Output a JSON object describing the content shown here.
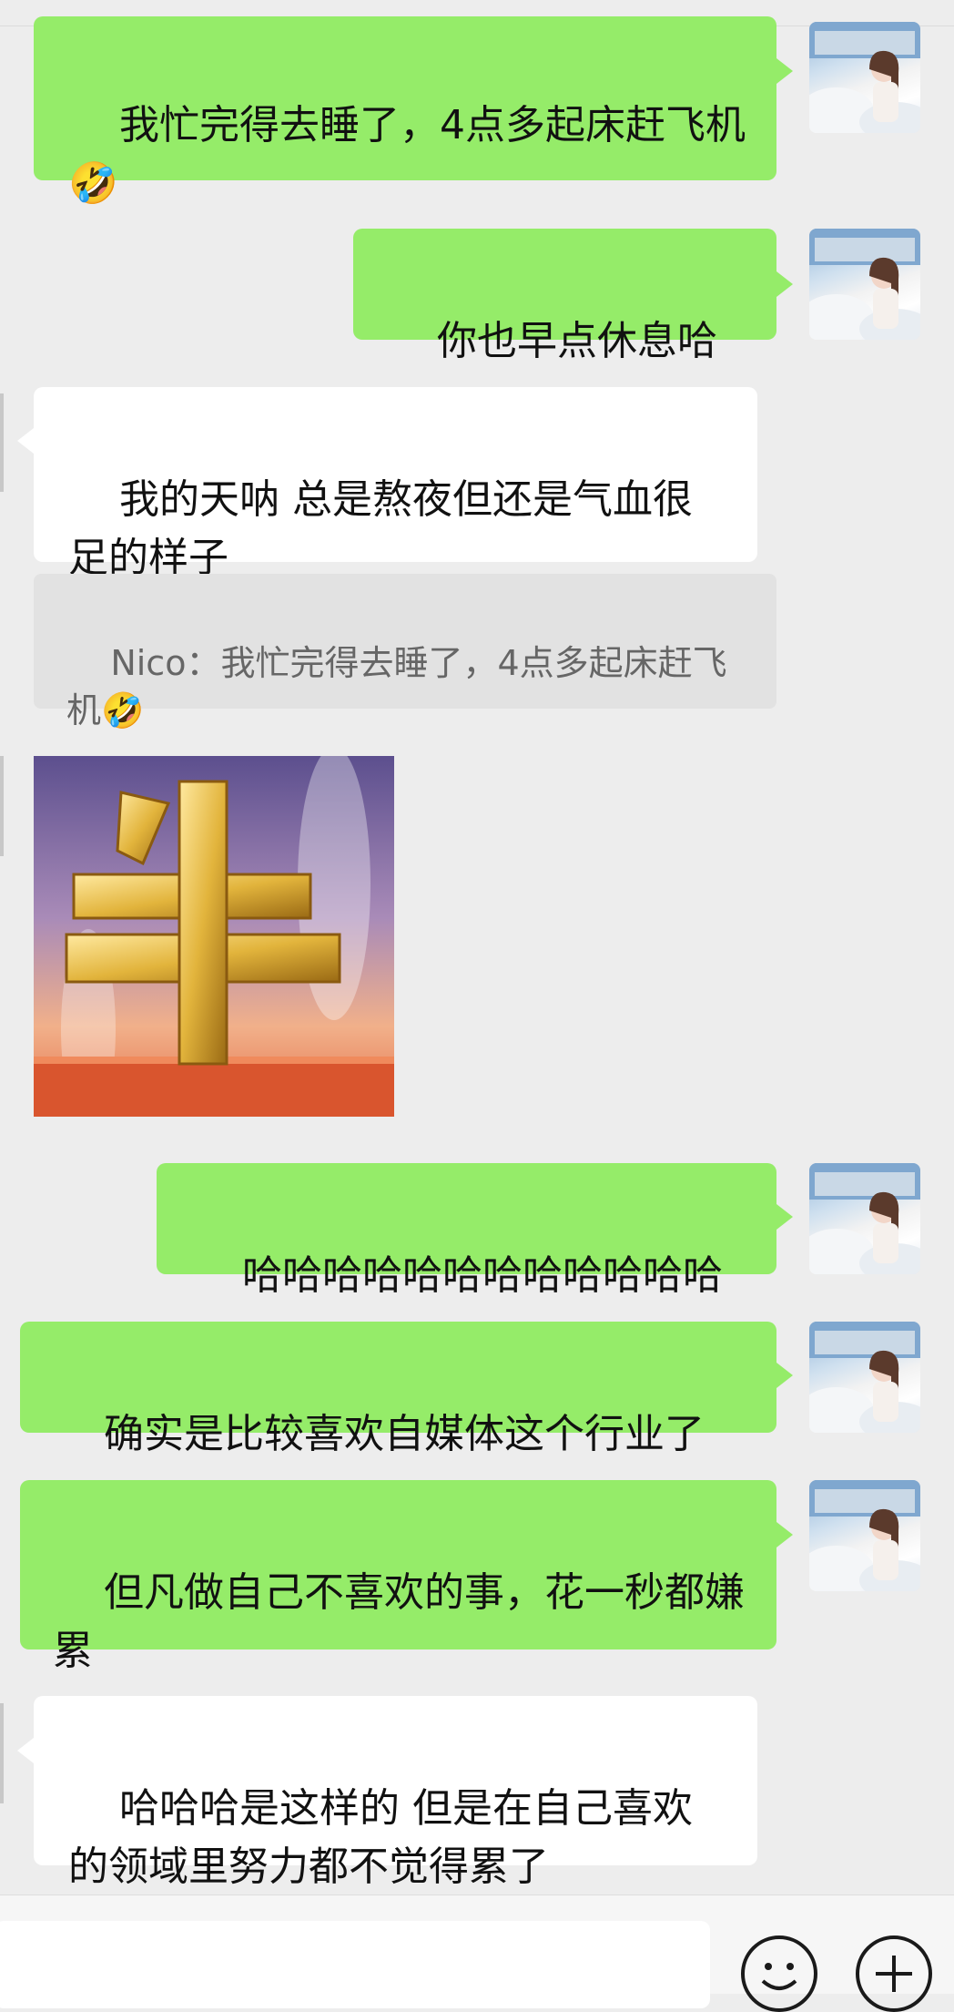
{
  "messages": [
    {
      "id": 1,
      "side": "out",
      "text": "我忙完得去睡了，4点多起床赶飞机🤣"
    },
    {
      "id": 2,
      "side": "out",
      "text": "你也早点休息哈～"
    },
    {
      "id": 3,
      "side": "in",
      "text": "我的天呐 总是熬夜但还是气血很足的样子"
    },
    {
      "id": 4,
      "side": "quote",
      "text": "Nico：我忙完得去睡了，4点多起床赶飞机🤣"
    },
    {
      "id": 5,
      "side": "in",
      "type": "sticker",
      "sticker": "niu-gold-character",
      "sticker_text": "牛"
    },
    {
      "id": 6,
      "side": "out",
      "text": "哈哈哈哈哈哈哈哈哈哈哈哈"
    },
    {
      "id": 7,
      "side": "out",
      "text": "确实是比较喜欢自媒体这个行业了"
    },
    {
      "id": 8,
      "side": "out",
      "text": "但凡做自己不喜欢的事，花一秒都嫌累"
    },
    {
      "id": 9,
      "side": "in",
      "text": "哈哈哈是这样的 但是在自己喜欢的领域里努力都不觉得累了"
    }
  ],
  "colors": {
    "background": "#ededed",
    "outgoing_bubble": "#95ec69",
    "incoming_bubble": "#ffffff",
    "quote_background": "#e2e2e2"
  },
  "input_bar": {
    "emoji_button": "emoji-icon",
    "plus_button": "plus-icon"
  }
}
